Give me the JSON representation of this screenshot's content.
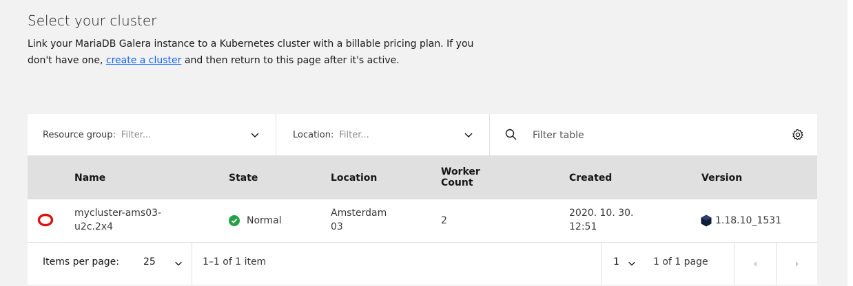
{
  "header": {
    "title": "Select your cluster",
    "desc_before": "Link your MariaDB Galera instance to a Kubernetes cluster with a billable pricing plan. If you don't have one, ",
    "desc_link": "create a cluster",
    "desc_after": " and then return to this page after it's active."
  },
  "toolbar": {
    "resource_group_label": "Resource group:",
    "resource_group_placeholder": "Filter...",
    "location_label": "Location:",
    "location_placeholder": "Filter...",
    "search_placeholder": "Filter table"
  },
  "table": {
    "columns": {
      "name": "Name",
      "state": "State",
      "location": "Location",
      "worker_count_line1": "Worker",
      "worker_count_line2": "Count",
      "created": "Created",
      "version": "Version"
    },
    "rows": [
      {
        "name_line1": "mycluster-ams03-",
        "name_line2": "u2c.2x4",
        "state": "Normal",
        "location_line1": "Amsterdam",
        "location_line2": "03",
        "worker_count": "2",
        "created_line1": "2020. 10. 30.",
        "created_line2": "12:51",
        "version": "1.18.10_1531"
      }
    ]
  },
  "pagination": {
    "items_per_page_label": "Items per page:",
    "items_per_page_value": "25",
    "range_text": "1–1 of 1 item",
    "page_value": "1",
    "page_of_text": "1 of 1 page"
  },
  "colors": {
    "link": "#0f62fe",
    "status_ok": "#24a148",
    "openshift_red": "#e01010",
    "kubernetes_icon": "#0f1c3a"
  }
}
